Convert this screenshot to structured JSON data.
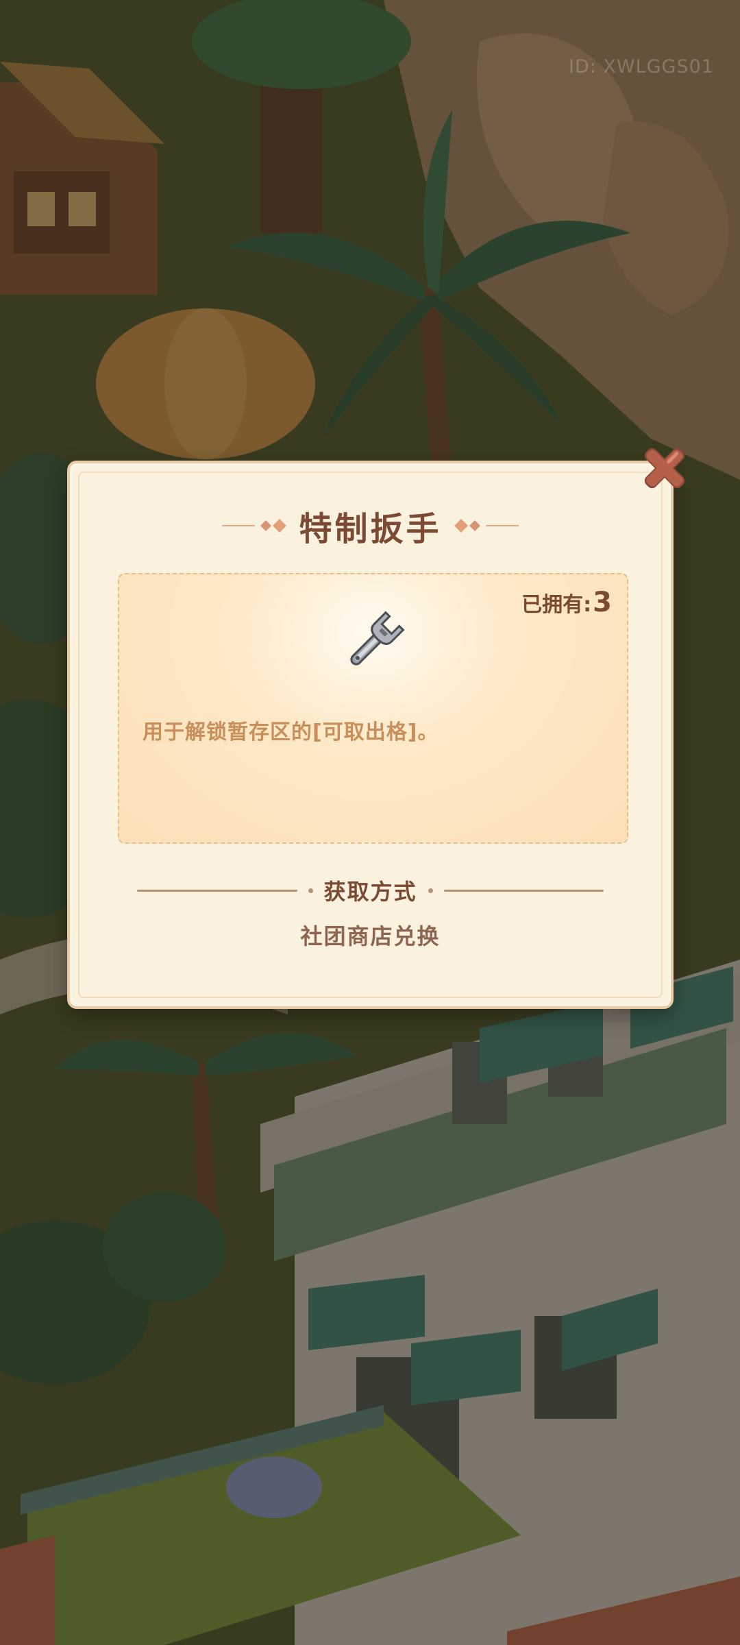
{
  "user_id_text": "ID: XWLGGS01",
  "popup": {
    "title": "特制扳手",
    "owned_label": "已拥有:",
    "owned_count": "3",
    "item_icon": "wrench-icon",
    "description": "用于解锁暂存区的[可取出格]。",
    "obtain_section_label": "获取方式",
    "obtain_method": "社团商店兑换",
    "close_icon": "close-icon"
  },
  "colors": {
    "title_brown": "#7a4a32",
    "description_tan": "#c98f5a",
    "popup_bg": "#fbf1df",
    "close_red": "#b5614a"
  }
}
